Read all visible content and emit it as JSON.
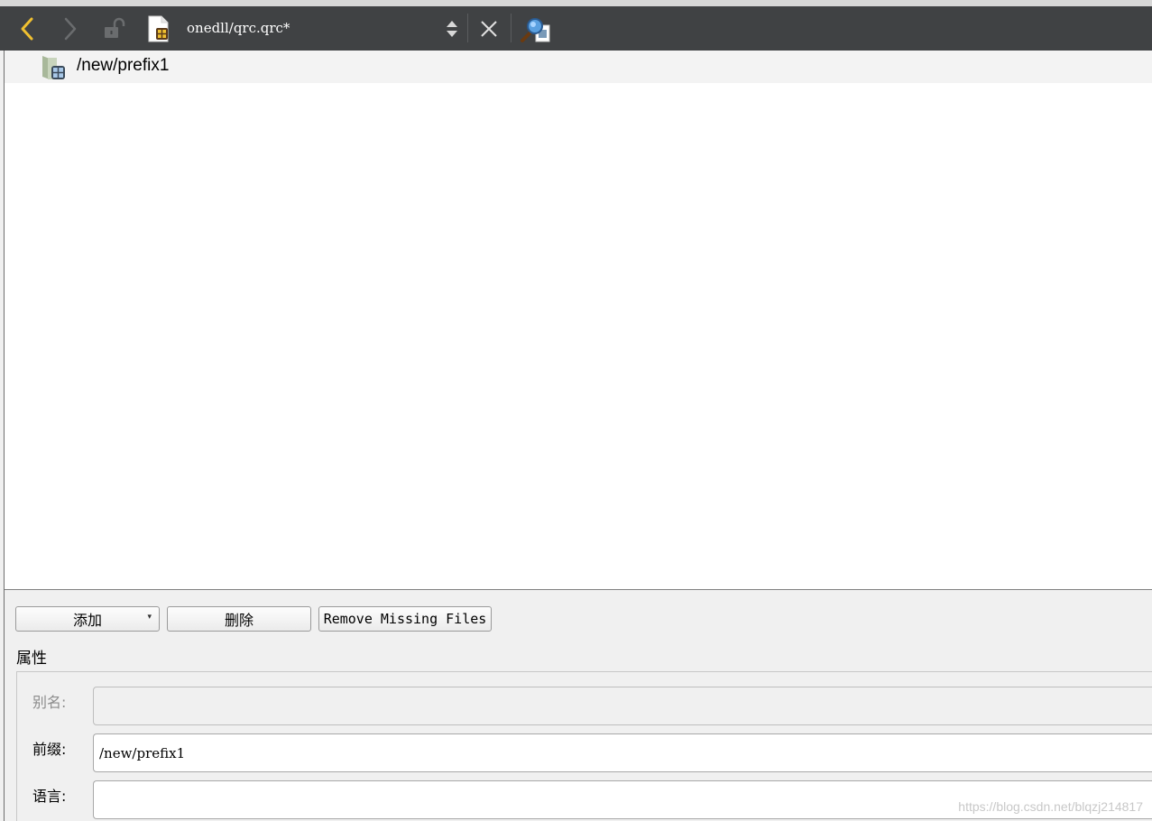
{
  "toolbar": {
    "back_icon": "chevron-left-icon",
    "forward_icon": "chevron-right-icon",
    "lock_icon": "lock-open-icon",
    "file_icon": "qrc-file-icon",
    "document_title": "onedll/qrc.qrc*",
    "updown_icon": "up-down-arrows-icon",
    "close_icon": "close-icon",
    "split_icon": "split-view-icon",
    "accent_color": "#f0c030"
  },
  "tree": {
    "items": [
      {
        "icon": "prefix-folder-icon",
        "label": "/new/prefix1"
      }
    ]
  },
  "actions": {
    "add_label": "添加",
    "remove_label": "删除",
    "remove_missing_label": "Remove Missing Files"
  },
  "properties": {
    "title": "属性",
    "alias_label": "别名:",
    "alias_value": "",
    "prefix_label": "前缀:",
    "prefix_value": "/new/prefix1",
    "language_label": "语言:",
    "language_value": ""
  },
  "watermark": "https://blog.csdn.net/blqzj214817"
}
